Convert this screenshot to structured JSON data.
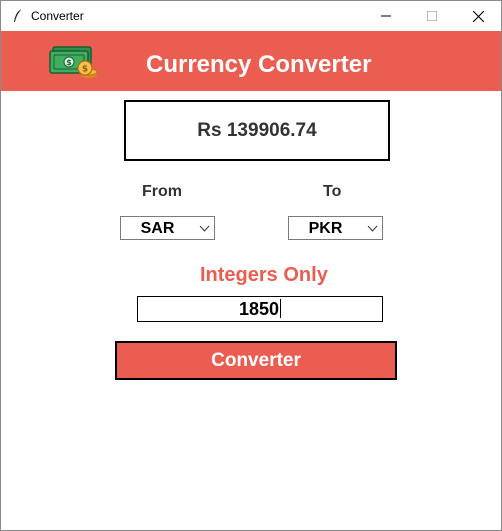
{
  "window": {
    "title": "Converter",
    "app_icon": "feather-icon",
    "controls": [
      "minimize-icon",
      "maximize-icon",
      "close-icon"
    ]
  },
  "header": {
    "title": "Currency Converter",
    "icon": "money-icon",
    "bg_color": "#ec5d51"
  },
  "result": {
    "text": "Rs 139906.74"
  },
  "from": {
    "label": "From",
    "selected": "SAR"
  },
  "to": {
    "label": "To",
    "selected": "PKR"
  },
  "amount": {
    "hint": "Integers Only",
    "value": "1850"
  },
  "convert_button": {
    "label": "Converter"
  },
  "colors": {
    "accent": "#ec5d51",
    "text_dark": "#333333"
  }
}
